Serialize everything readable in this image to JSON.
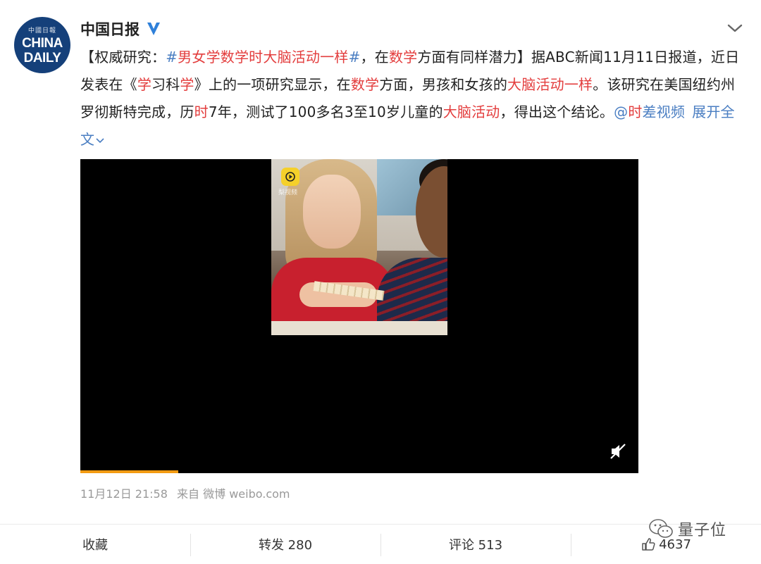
{
  "post": {
    "author": "中国日报",
    "avatar": {
      "small_text": "中國日報",
      "line1": "CHINA",
      "line2": "DAILY"
    },
    "text_segments": [
      {
        "text": "【权威研究：",
        "style": "plain"
      },
      {
        "text": "#",
        "style": "blue"
      },
      {
        "text": "男女学数学时大脑活动一样",
        "style": "hl"
      },
      {
        "text": "#",
        "style": "blue"
      },
      {
        "text": "，在",
        "style": "plain"
      },
      {
        "text": "数学",
        "style": "hl"
      },
      {
        "text": "方面有同样潜力】据ABC新闻11月11日报道，近日发表在《",
        "style": "plain"
      },
      {
        "text": "学",
        "style": "hl"
      },
      {
        "text": "习科",
        "style": "plain"
      },
      {
        "text": "学",
        "style": "hl"
      },
      {
        "text": "》上的一项研究显示，在",
        "style": "plain"
      },
      {
        "text": "数学",
        "style": "hl"
      },
      {
        "text": "方面，男孩和女孩的",
        "style": "plain"
      },
      {
        "text": "大脑活动一样",
        "style": "hl"
      },
      {
        "text": "。该研究在美国纽约州罗彻斯特完成，历",
        "style": "plain"
      },
      {
        "text": "时",
        "style": "hl"
      },
      {
        "text": "7年，测试了100多名3至10岁儿童的",
        "style": "plain"
      },
      {
        "text": "大脑活动",
        "style": "hl"
      },
      {
        "text": "，得出这个结论。",
        "style": "plain"
      },
      {
        "text": "@",
        "style": "link"
      },
      {
        "text": "时",
        "style": "hl"
      },
      {
        "text": "差视频",
        "style": "link"
      }
    ],
    "expand_label": "展开全文",
    "video": {
      "watermark": "梨视频",
      "progress_fraction": 0.175
    },
    "timestamp": "11月12日 21:58",
    "source": "来自 微博 weibo.com"
  },
  "actions": {
    "favorite": "收藏",
    "repost": "转发 280",
    "comment": "评论 513",
    "like": "4637"
  },
  "brand": "量子位",
  "colors": {
    "highlight": "#e33d3d",
    "link": "#4a7ec2",
    "verified": "#2f80d9",
    "progress": "#f29b12"
  }
}
